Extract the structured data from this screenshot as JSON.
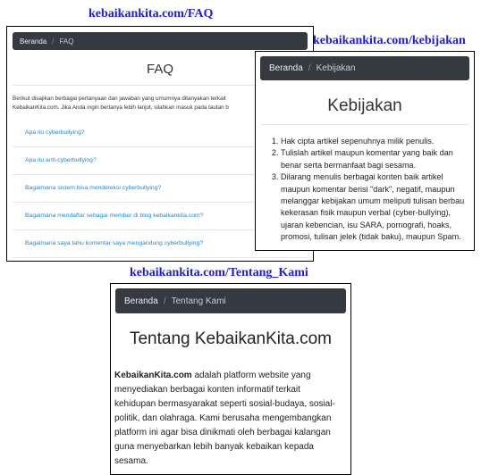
{
  "labels": {
    "faq_url": "kebaikankita.com/FAQ",
    "kebijakan_url": "kebaikankita.com/kebijakan",
    "tentang_url": "kebaikankita.com/Tentang_Kami"
  },
  "faq": {
    "breadcrumb_home": "Beranda",
    "breadcrumb_sep": "/",
    "breadcrumb_current": "FAQ",
    "title": "FAQ",
    "intro_line1": "Berikut disajikan berbagai pertanyaan dan jawaban yang umumnya ditanyakan terkait",
    "intro_line2": "KebaikanKita.com. Jika Anda ingin bertanya lebih lanjut, silahkan masuk pada tautan b",
    "questions": [
      "Apa itu cyberbullying?",
      "Apa itu anti-cyberbullying?",
      "Bagaimana sistem bisa mendeteksi cyberbullying?",
      "Bagaimana mendaftar sebagai member di blog kebaikankita.com?",
      "Bagaimana saya tahu komentar saya mengandung cyberbullying?"
    ]
  },
  "kebijakan": {
    "breadcrumb_home": "Beranda",
    "breadcrumb_sep": "/",
    "breadcrumb_current": "Kebijakan",
    "title": "Kebijakan",
    "items": [
      "Hak cipta artikel sepenuhnya milik penulis.",
      "Tulislah artikel maupun komentar yang baik dan benar serta bermanfaat bagi sesama.",
      "Dilarang menulis berbagai konten baik artikel maupun komentar berisi \"dark\", negatif, maupun melanggar kebijakan umum meliputi tulisan berbau kekerasan fisik maupun verbal (cyber-bullying), ujaran kebencian, isu SARA, pornografi, hoaks, promosi, tulisan jelek (tidak baku), maupun Spam."
    ]
  },
  "tentang": {
    "breadcrumb_home": "Beranda",
    "breadcrumb_sep": "/",
    "breadcrumb_current": "Tentang Kami",
    "title": "Tentang KebaikanKita.com",
    "body_bold": "KebaikanKita.com",
    "body_rest": " adalah platform website yang menyediakan berbagai konten informatif terkait kehidupan bermasyarakat seperti sosial-budaya, sosial-politik, dan olahraga. Kami berusaha mengembangkan platform ini agar bisa dinikmati oleh berbagai kalangan guna menyebarkan lebih banyak kebaikan kepada sesama."
  }
}
